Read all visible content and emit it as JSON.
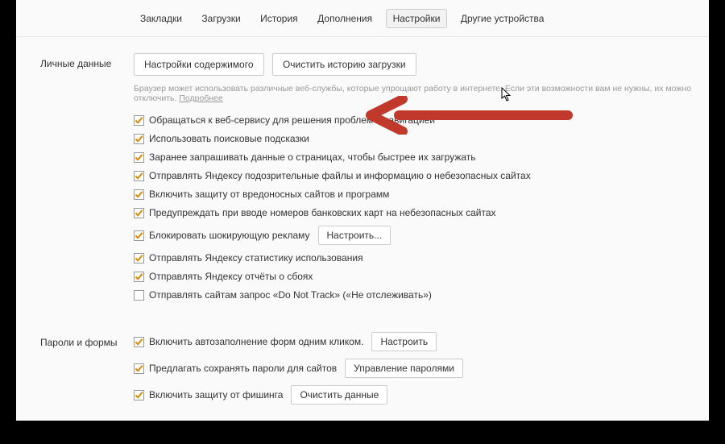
{
  "tabs": {
    "bookmarks": "Закладки",
    "downloads": "Загрузки",
    "history": "История",
    "addons": "Дополнения",
    "settings": "Настройки",
    "other_devices": "Другие устройства"
  },
  "personal": {
    "label": "Личные данные",
    "btn_content": "Настройки содержимого",
    "btn_clear": "Очистить историю загрузки",
    "hint": "Браузер может использовать различные веб-службы, которые упрощают работу в интернете. Если эти возможности вам не нужны, их можно отключить. ",
    "hint_more": "Подробнее",
    "items": [
      {
        "checked": true,
        "label": "Обращаться к веб-сервису для решения проблем с навигацией"
      },
      {
        "checked": true,
        "label": "Использовать поисковые подсказки"
      },
      {
        "checked": true,
        "label": "Заранее запрашивать данные о страницах, чтобы быстрее их загружать"
      },
      {
        "checked": true,
        "label": "Отправлять Яндексу подозрительные файлы и информацию о небезопасных сайтах"
      },
      {
        "checked": true,
        "label": "Включить защиту от вредоносных сайтов и программ"
      },
      {
        "checked": true,
        "label": "Предупреждать при вводе номеров банковских карт на небезопасных сайтах"
      },
      {
        "checked": true,
        "label": "Блокировать шокирующую рекламу",
        "btn": "Настроить..."
      },
      {
        "checked": true,
        "label": "Отправлять Яндексу статистику использования"
      },
      {
        "checked": true,
        "label": "Отправлять Яндексу отчёты о сбоях"
      },
      {
        "checked": false,
        "label": "Отправлять сайтам запрос «Do Not Track» («Не отслеживать»)"
      }
    ]
  },
  "passwords": {
    "label": "Пароли и формы",
    "items": [
      {
        "checked": true,
        "label": "Включить автозаполнение форм одним кликом.",
        "btn": "Настроить"
      },
      {
        "checked": true,
        "label": "Предлагать сохранять пароли для сайтов",
        "btn": "Управление паролями"
      },
      {
        "checked": true,
        "label": "Включить защиту от фишинга",
        "btn": "Очистить данные"
      }
    ]
  }
}
